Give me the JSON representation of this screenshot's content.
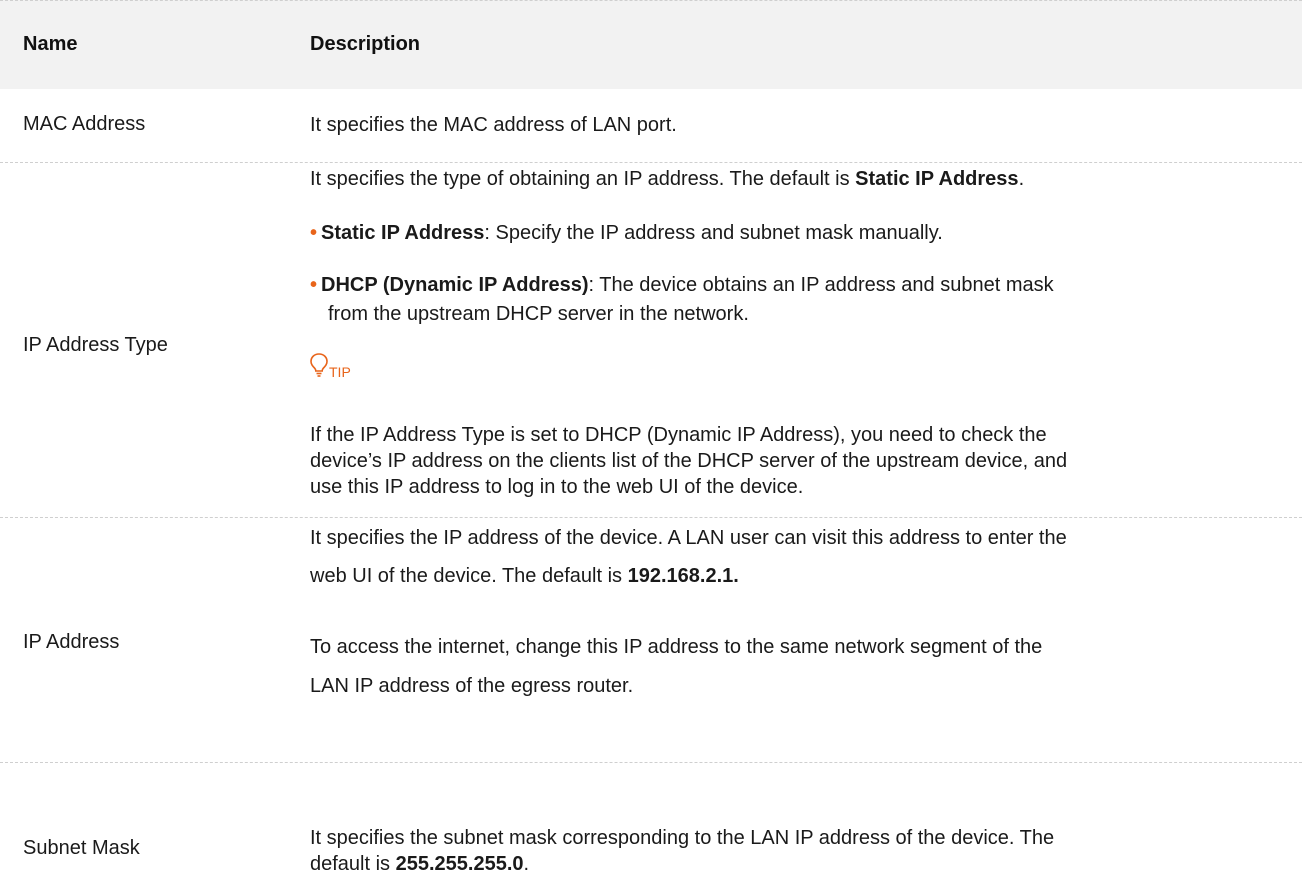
{
  "header": {
    "name": "Name",
    "description": "Description"
  },
  "rows": {
    "mac": {
      "name": "MAC Address",
      "desc": "It specifies the MAC address of LAN port."
    },
    "iptype": {
      "name": "IP Address Type",
      "intro_prefix": "It specifies the type of obtaining an IP address. The default is ",
      "intro_bold": "Static IP Address",
      "intro_suffix": ".",
      "bullet1_bold": "Static IP Address",
      "bullet1_text": ": Specify the IP address and subnet mask manually.",
      "bullet2_bold": "DHCP (Dynamic IP Address)",
      "bullet2_text_line1": ": The device obtains an IP address and subnet mask",
      "bullet2_text_line2": "from the upstream DHCP server in the network.",
      "tip_label": "TIP",
      "tip_line1": "If the IP Address Type is set to DHCP (Dynamic IP Address), you need to check the",
      "tip_line2": "device’s IP address on the clients list of the DHCP server of the upstream device, and",
      "tip_line3": "use this IP address to log in to the web UI of the device."
    },
    "ip": {
      "name": "IP Address",
      "line1": "It specifies the IP address of the device. A LAN user can visit this address to enter the",
      "line2_prefix": "web UI of the device. The default is ",
      "line2_bold": "192.168.2.1.",
      "line3": "To access the internet, change this IP address to the same network segment of the",
      "line4": "LAN IP address of the egress router."
    },
    "mask": {
      "name": "Subnet Mask",
      "line1": "It specifies the subnet mask corresponding to the LAN IP address of the device. The",
      "line2_prefix": "default is ",
      "line2_bold": "255.255.255.0",
      "line2_suffix": "."
    }
  },
  "colors": {
    "accent": "#e8641a",
    "header_bg": "#f2f2f2",
    "divider": "#cfcfcf"
  }
}
